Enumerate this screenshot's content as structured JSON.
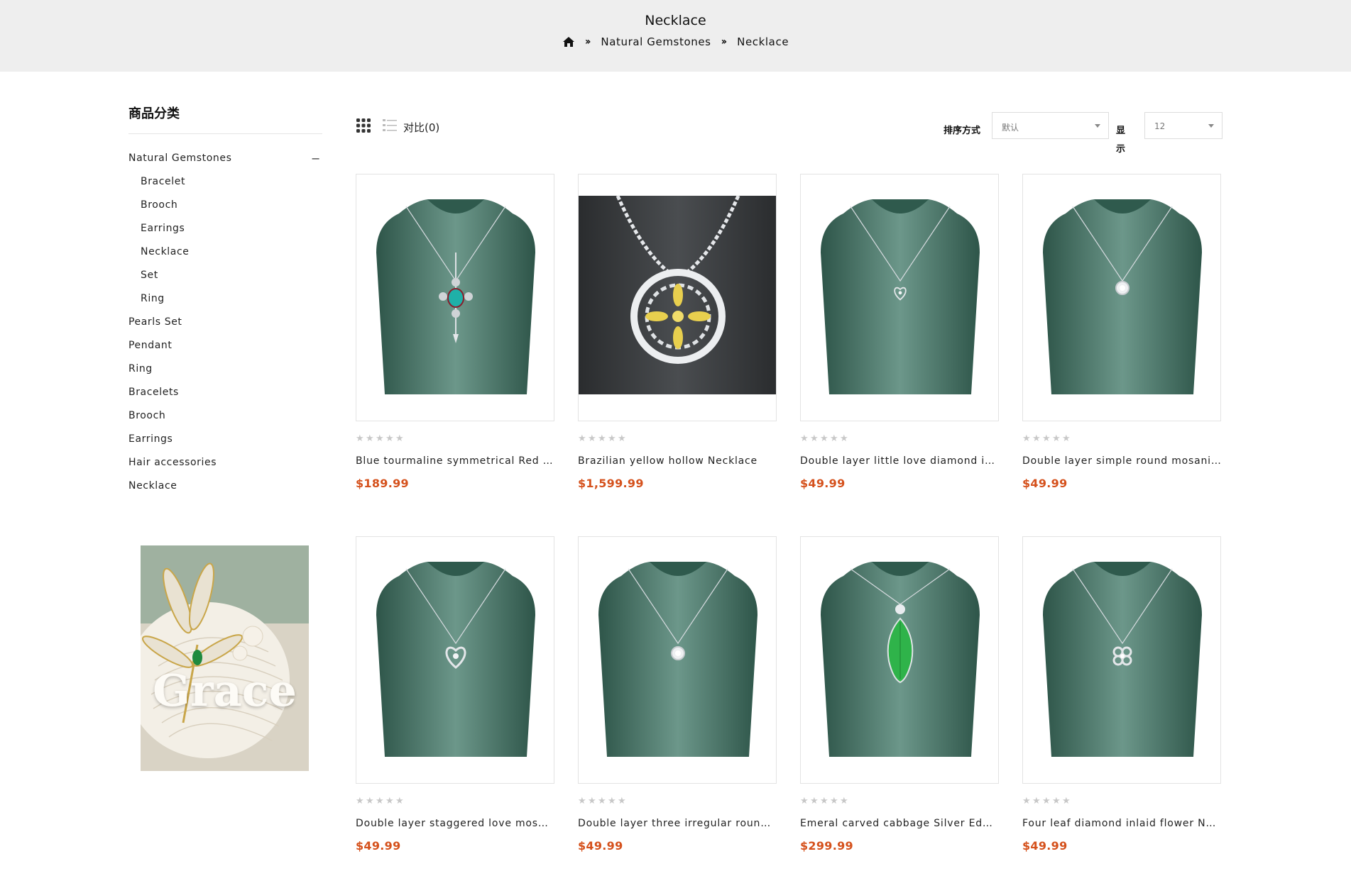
{
  "header": {
    "title": "Necklace",
    "breadcrumb": [
      "Natural Gemstones",
      "Necklace"
    ]
  },
  "sidebar": {
    "title": "商品分类",
    "categories": [
      {
        "label": "Natural Gemstones",
        "expanded": true
      },
      {
        "label": "Bracelet",
        "sub": true
      },
      {
        "label": "Brooch",
        "sub": true
      },
      {
        "label": "Earrings",
        "sub": true
      },
      {
        "label": "Necklace",
        "sub": true
      },
      {
        "label": "Set",
        "sub": true
      },
      {
        "label": "Ring",
        "sub": true
      },
      {
        "label": "Pearls Set"
      },
      {
        "label": "Pendant"
      },
      {
        "label": "Ring"
      },
      {
        "label": "Bracelets"
      },
      {
        "label": "Brooch"
      },
      {
        "label": "Earrings"
      },
      {
        "label": "Hair accessories"
      },
      {
        "label": "Necklace"
      }
    ],
    "toggle_symbol": "−",
    "banner_text": "Grace"
  },
  "toolbar": {
    "compare_label": "对比(0)",
    "sort_label": "排序方式",
    "sort_value": "默认",
    "show_label": "显示",
    "show_value": "12"
  },
  "products": [
    {
      "name": "Blue tourmaline symmetrical Red Zircon Necklace",
      "price": "$189.99",
      "rating": 0,
      "style": "pendant-blue",
      "bg": "green"
    },
    {
      "name": "Brazilian yellow hollow Necklace",
      "price": "$1,599.99",
      "rating": 0,
      "style": "big-yellow",
      "bg": "dark"
    },
    {
      "name": "Double layer little love diamond inlaid Necklace",
      "price": "$49.99",
      "rating": 0,
      "style": "heart-small",
      "bg": "green"
    },
    {
      "name": "Double layer simple round mosanite Necklace",
      "price": "$49.99",
      "rating": 0,
      "style": "round",
      "bg": "green"
    },
    {
      "name": "Double layer staggered love mosanite Necklace",
      "price": "$49.99",
      "rating": 0,
      "style": "heart",
      "bg": "green"
    },
    {
      "name": "Double layer three irregular round Necklace",
      "price": "$49.99",
      "rating": 0,
      "style": "round2",
      "bg": "green"
    },
    {
      "name": "Emeral carved cabbage Silver Edge Necklace",
      "price": "$299.99",
      "rating": 0,
      "style": "green-leaf",
      "bg": "green"
    },
    {
      "name": "Four leaf diamond inlaid flower Necklace",
      "price": "$49.99",
      "rating": 0,
      "style": "flower",
      "bg": "green"
    }
  ],
  "colors": {
    "price": "#d5511c",
    "header_bg": "#eeeeee",
    "bust_green": "#3f6b5d"
  }
}
